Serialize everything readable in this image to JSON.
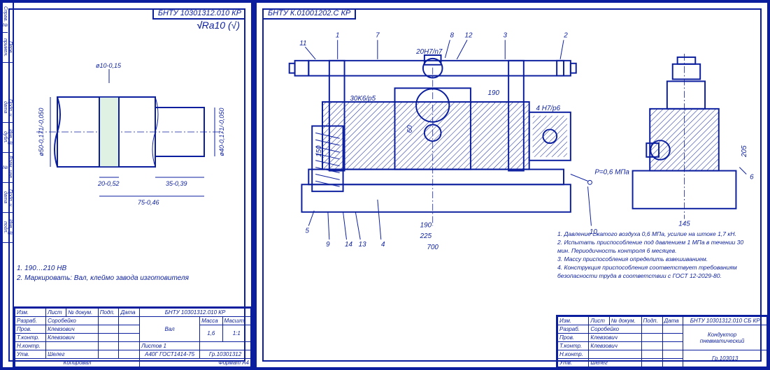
{
  "left": {
    "doc_code": "БНТУ 10301312.010 КР",
    "surface": "Ra10",
    "surface_paren": "(√)",
    "dims": {
      "d50": "ø50-0,171/-0,050",
      "d40": "ø40-0,171/-0,050",
      "d10": "ø10-0,15",
      "len20": "20-0,52",
      "len35": "35-0,39",
      "len75": "75-0,46"
    },
    "notes": {
      "n1": "1. 190…210 HB",
      "n2": "2. Маркировать: Вал, клеймо завода изготовителя"
    },
    "title_block": {
      "tag": "БНТУ 10301312.010 КР",
      "name": "Вал",
      "material": "А40Г ГОСТ1414-75",
      "group": "Гр.10301312",
      "mass": "1,6",
      "scale": "1:1",
      "sheets_lbl": "Листов",
      "sheets": "1",
      "r1a": "Изм.",
      "r1b": "Лист",
      "r1c": "№ докум.",
      "r1d": "Подп.",
      "r1e": "Дата",
      "r2a": "Разраб.",
      "r2b": "Соробейко",
      "r3a": "Пров.",
      "r3b": "Клевзович",
      "r4a": "Т.контр.",
      "r4b": "Клевзович",
      "r5a": "Н.контр.",
      "r5b": "",
      "r6a": "Утв.",
      "r6b": "Шелег",
      "footer_l": "Копировал",
      "footer_r": "Формат   А4"
    },
    "side": [
      "Справ. №",
      "Перв. примен.",
      "",
      "Подп. и дата",
      "Инв. № дубл.",
      "Взам. инв. №",
      "Подп. и дата",
      "Инв. № подл."
    ]
  },
  "right": {
    "doc_code": "БНТУ К.01001202.С КР",
    "balloons": {
      "b1": "1",
      "b2": "2",
      "b3": "3",
      "b5": "5",
      "b6": "6",
      "b7": "7",
      "b8": "8",
      "b9": "9",
      "b10": "10",
      "b11": "11",
      "b12": "12",
      "b13": "13",
      "b14": "14",
      "b4": "4"
    },
    "labels": {
      "fit1": "20H7/n7",
      "fit2": "30K6/p5",
      "fit3": "4 H7/p6",
      "dim60": "60",
      "dim190a": "190",
      "dim190b": "190",
      "dim225": "225",
      "dim7xx": "700",
      "dim145": "145",
      "dim205": "205",
      "dim150": "150",
      "press": "P=0,6 МПа"
    },
    "notes": {
      "n1": "1. Давление сжатого воздуха 0,6 МПа, усилие на штоке 1,7 кН.",
      "n2": "2. Испытать приспособление под давлением 1 МПа в течении 30 мин. Периодичность контроля 6 месяцев.",
      "n3": "3. Массу приспособления определить взвешиванием.",
      "n4": "4. Конструкция приспособления соответствует требованиям безопасности труда в соответствии с ГОСТ 12-2029-80."
    },
    "title_block": {
      "tag": "БНТУ 10301312.010 СБ КР",
      "name1": "Кондуктор",
      "name2": "пневматический",
      "group": "Гр.103013",
      "r1a": "Изм.",
      "r1b": "Лист",
      "r1c": "№ докум.",
      "r1d": "Подп.",
      "r1e": "Дата",
      "r2a": "Разраб.",
      "r2b": "Соробейко",
      "r3a": "Пров.",
      "r3b": "Клевзович",
      "r4a": "Т.контр.",
      "r4b": "Клевзович",
      "r5a": "Н.контр.",
      "r5b": "",
      "r6a": "Утв.",
      "r6b": "Шелег"
    }
  }
}
